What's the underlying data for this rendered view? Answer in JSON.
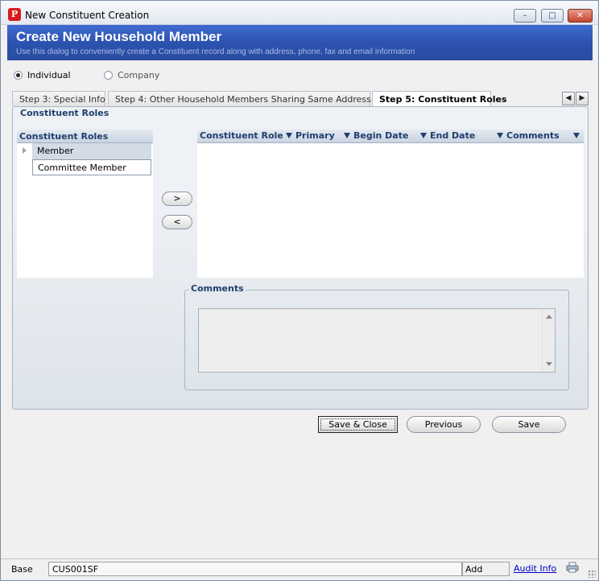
{
  "window": {
    "title": "New Constituent Creation",
    "app_icon": "P",
    "controls": {
      "minimize": "–",
      "maximize": "□",
      "close": "✕"
    }
  },
  "banner": {
    "title": "Create New Household Member",
    "subtitle": "Use this dialog to conveniently create a Constituent record along with address, phone, fax and email information"
  },
  "type_options": [
    {
      "label": "Individual",
      "selected": true
    },
    {
      "label": "Company",
      "selected": false
    }
  ],
  "tabs": [
    {
      "label": "Step 3: Special Info",
      "active": false
    },
    {
      "label": "Step 4: Other Household Members Sharing Same Address",
      "active": false
    },
    {
      "label": "Step 5: Constituent Roles",
      "active": true
    }
  ],
  "tab_nav": {
    "prev": "◀",
    "next": "▶"
  },
  "section_title": "Constituent Roles",
  "roles_list": {
    "header": "Constituent Roles",
    "items": [
      "Member",
      "Committee Member"
    ]
  },
  "move_buttons": {
    "add": ">",
    "remove": "<"
  },
  "assigned_grid": {
    "columns": [
      "Constituent Role",
      "Primary",
      "Begin Date",
      "End Date",
      "Comments"
    ],
    "rows": []
  },
  "comments": {
    "legend": "Comments",
    "value": ""
  },
  "actions": {
    "save_close": "Save & Close",
    "previous": "Previous",
    "save": "Save"
  },
  "status_bar": {
    "base": "Base",
    "form_code": "CUS001SF",
    "mode": "Add",
    "audit_info": "Audit Info"
  },
  "colors": {
    "banner": "#2c52b0",
    "header_text": "#1f3e6e",
    "close_button": "#c4452f"
  }
}
